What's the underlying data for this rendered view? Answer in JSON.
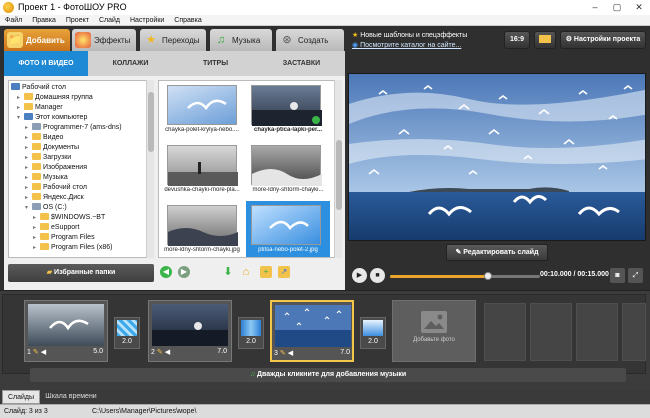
{
  "window": {
    "title": "Проект 1 - ФотоШОУ PRO",
    "controls": [
      "–",
      "▢",
      "✕"
    ]
  },
  "menu": [
    "Файл",
    "Правка",
    "Проект",
    "Слайд",
    "Настройки",
    "Справка"
  ],
  "main_tabs": [
    {
      "label": "Добавить",
      "icon": "add-folder-icon"
    },
    {
      "label": "Эффекты",
      "icon": "effects-icon"
    },
    {
      "label": "Переходы",
      "icon": "transitions-star-icon"
    },
    {
      "label": "Музыка",
      "icon": "music-icon"
    },
    {
      "label": "Создать",
      "icon": "film-reel-icon"
    }
  ],
  "sub_tabs": [
    "ФОТО И ВИДЕО",
    "КОЛЛАЖИ",
    "ТИТРЫ",
    "ЗАСТАВКИ"
  ],
  "tree": [
    {
      "label": "Рабочий стол",
      "type": "desktop"
    },
    {
      "label": "Домашняя группа",
      "type": "folder"
    },
    {
      "label": "Manager",
      "type": "folder"
    },
    {
      "label": "Этот компьютер",
      "type": "pc"
    },
    {
      "label": "Programmer-7 (ams-dns)",
      "type": "drive"
    },
    {
      "label": "Видео",
      "type": "folder"
    },
    {
      "label": "Документы",
      "type": "folder"
    },
    {
      "label": "Загрузки",
      "type": "folder"
    },
    {
      "label": "Изображения",
      "type": "folder"
    },
    {
      "label": "Музыка",
      "type": "folder"
    },
    {
      "label": "Рабочий стол",
      "type": "folder"
    },
    {
      "label": "Яндекс.Диск",
      "type": "folder"
    },
    {
      "label": "OS (C:)",
      "type": "drive"
    },
    {
      "label": "$WINDOWS.~BT",
      "type": "folder"
    },
    {
      "label": "eSupport",
      "type": "folder"
    },
    {
      "label": "Program Files",
      "type": "folder"
    },
    {
      "label": "Program Files (x86)",
      "type": "folder"
    }
  ],
  "thumbnails": [
    {
      "label": "chayka-polet-krylya-nebo....",
      "bold": false
    },
    {
      "label": "chayka-ptica-lapki-per...",
      "bold": true
    },
    {
      "label": "devushka-chayki-more-pla...",
      "bold": false
    },
    {
      "label": "more-ldny-shtorm-chayki...",
      "bold": false
    },
    {
      "label": "more-ldny-shtorm-chayki.jpg",
      "bold": false
    },
    {
      "label": "ptitsa-nebo-polet-2.jpg",
      "bold": false
    }
  ],
  "favorites_label": "Избранные папки",
  "right_top": {
    "new_templates": "Новые шаблоны и спецэффекты",
    "catalog_link": "Посмотрите каталог на сайте...",
    "aspect": "16:9",
    "settings": "Настройки проекта"
  },
  "edit_slide_label": "Редактировать слайд",
  "player": {
    "time": "00:10.000 / 00:15.000",
    "progress": 0.65
  },
  "slides": [
    {
      "number": "1",
      "duration": "5.0"
    },
    {
      "number": "2",
      "duration": "7.0"
    },
    {
      "number": "3",
      "duration": "7.0"
    }
  ],
  "transitions": [
    "2.0",
    "2.0",
    "2.0"
  ],
  "add_photo_label": "Добавьте фото",
  "music_hint": "Дважды кликните для добавления музыки",
  "bottom_tabs": [
    "Слайды",
    "Шкала времени"
  ],
  "status": {
    "slide_info": "Слайд: 3 из 3",
    "path": "C:\\Users\\Manager\\Pictures\\море\\"
  },
  "colors": {
    "accent_orange": "#e8a33a",
    "accent_blue": "#1e8ad6",
    "selected_yellow": "#f3c64b"
  }
}
